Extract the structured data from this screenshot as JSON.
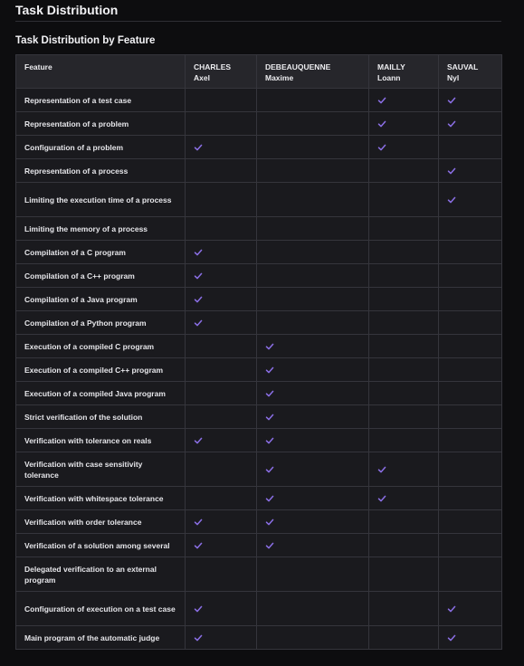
{
  "page": {
    "title": "Task Distribution",
    "section_title": "Task Distribution by Feature"
  },
  "table": {
    "headers": [
      {
        "key": "feature",
        "line1": "Feature",
        "line2": ""
      },
      {
        "key": "charles",
        "line1": "CHARLES",
        "line2": "Axel"
      },
      {
        "key": "debeau",
        "line1": "DEBEAUQUENNE",
        "line2": "Maxime"
      },
      {
        "key": "mailly",
        "line1": "MAILLY",
        "line2": "Loann"
      },
      {
        "key": "sauval",
        "line1": "SAUVAL",
        "line2": "Nyl"
      }
    ],
    "check_color": "#8b6fe6",
    "rows": [
      {
        "feature": "Representation of a test case",
        "lines": 1,
        "checks": [
          false,
          false,
          true,
          true
        ]
      },
      {
        "feature": "Representation of a problem",
        "lines": 1,
        "checks": [
          false,
          false,
          true,
          true
        ]
      },
      {
        "feature": "Configuration of a problem",
        "lines": 1,
        "checks": [
          true,
          false,
          true,
          false
        ]
      },
      {
        "feature": "Representation of a process",
        "lines": 1,
        "checks": [
          false,
          false,
          false,
          true
        ]
      },
      {
        "feature": "Limiting the execution time of a process",
        "lines": 2,
        "checks": [
          false,
          false,
          false,
          true
        ]
      },
      {
        "feature": "Limiting the memory of a process",
        "lines": 1,
        "checks": [
          false,
          false,
          false,
          false
        ]
      },
      {
        "feature": "Compilation of a C program",
        "lines": 1,
        "checks": [
          true,
          false,
          false,
          false
        ]
      },
      {
        "feature": "Compilation of a C++ program",
        "lines": 1,
        "checks": [
          true,
          false,
          false,
          false
        ]
      },
      {
        "feature": "Compilation of a Java program",
        "lines": 1,
        "checks": [
          true,
          false,
          false,
          false
        ]
      },
      {
        "feature": "Compilation of a Python program",
        "lines": 1,
        "checks": [
          true,
          false,
          false,
          false
        ]
      },
      {
        "feature": "Execution of a compiled C program",
        "lines": 1,
        "checks": [
          false,
          true,
          false,
          false
        ]
      },
      {
        "feature": "Execution of a compiled C++ program",
        "lines": 1,
        "checks": [
          false,
          true,
          false,
          false
        ]
      },
      {
        "feature": "Execution of a compiled Java program",
        "lines": 1,
        "checks": [
          false,
          true,
          false,
          false
        ]
      },
      {
        "feature": "Strict verification of the solution",
        "lines": 1,
        "checks": [
          false,
          true,
          false,
          false
        ]
      },
      {
        "feature": "Verification with tolerance on reals",
        "lines": 1,
        "checks": [
          true,
          true,
          false,
          false
        ]
      },
      {
        "feature": "Verification with case sensitivity tolerance",
        "lines": 2,
        "checks": [
          false,
          true,
          true,
          false
        ]
      },
      {
        "feature": "Verification with whitespace tolerance",
        "lines": 1,
        "checks": [
          false,
          true,
          true,
          false
        ]
      },
      {
        "feature": "Verification with order tolerance",
        "lines": 1,
        "checks": [
          true,
          true,
          false,
          false
        ]
      },
      {
        "feature": "Verification of a solution among several",
        "lines": 1,
        "checks": [
          true,
          true,
          false,
          false
        ]
      },
      {
        "feature": "Delegated verification to an external program",
        "lines": 2,
        "checks": [
          false,
          false,
          false,
          false
        ]
      },
      {
        "feature": "Configuration of execution on a test case",
        "lines": 2,
        "checks": [
          true,
          false,
          false,
          true
        ]
      },
      {
        "feature": "Main program of the automatic judge",
        "lines": 1,
        "checks": [
          true,
          false,
          false,
          true
        ]
      }
    ]
  }
}
